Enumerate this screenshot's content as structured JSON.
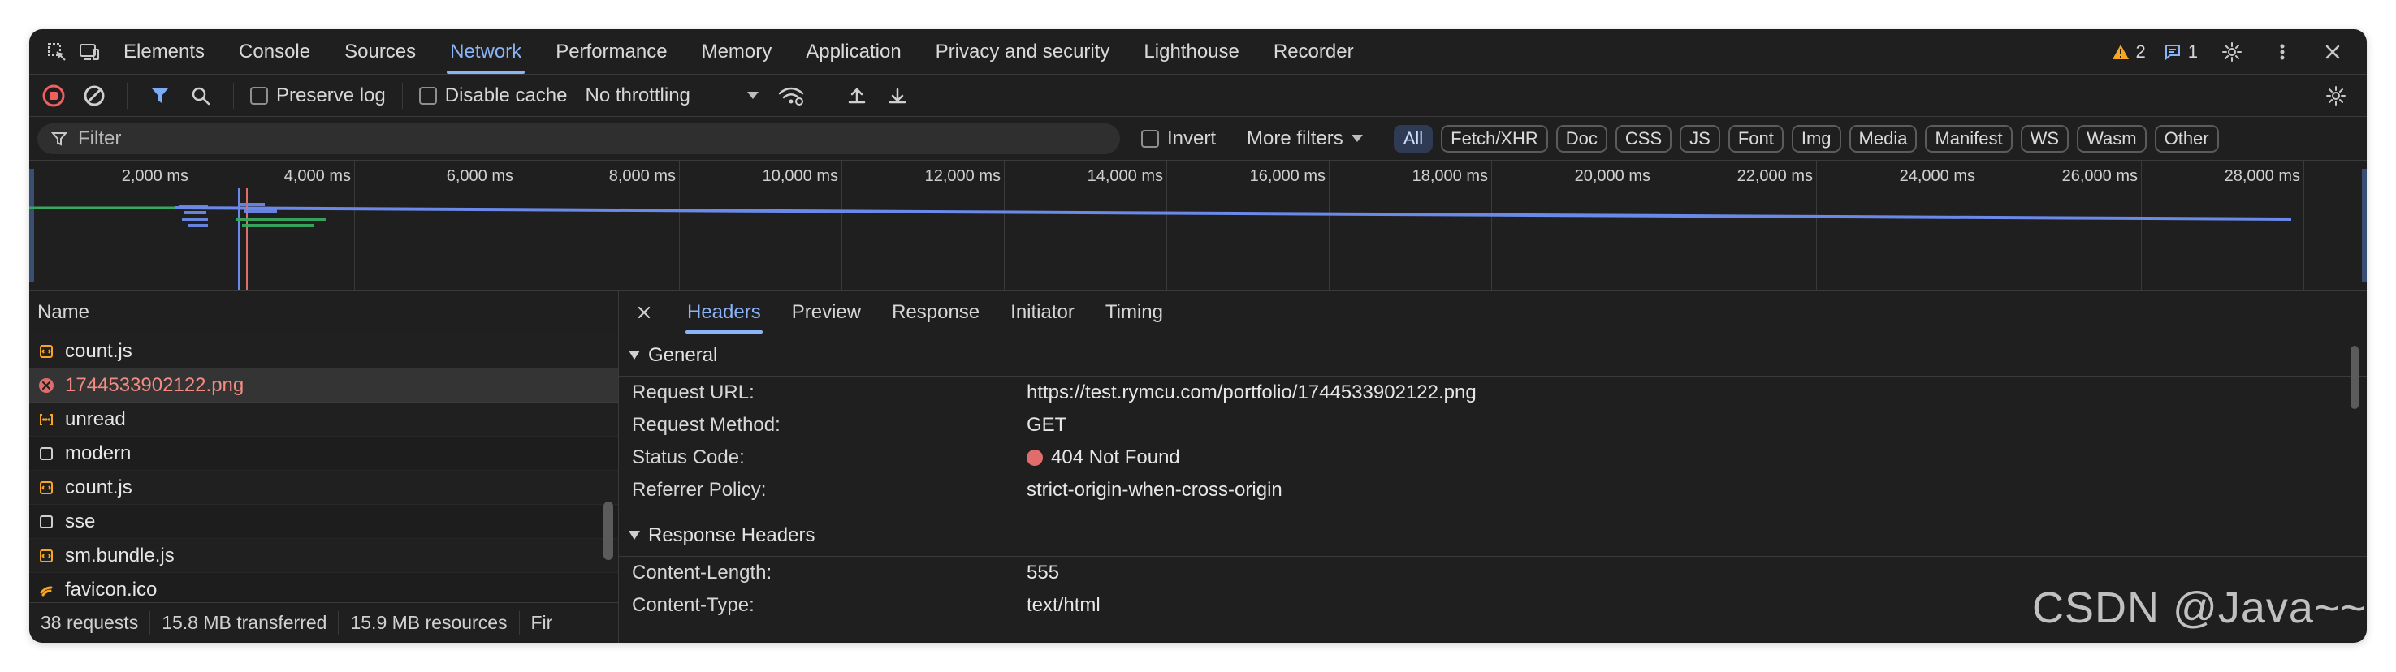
{
  "topbar": {
    "tabs": [
      "Elements",
      "Console",
      "Sources",
      "Network",
      "Performance",
      "Memory",
      "Application",
      "Privacy and security",
      "Lighthouse",
      "Recorder"
    ],
    "active_tab": "Network",
    "warnings_count": "2",
    "messages_count": "1"
  },
  "toolbar": {
    "preserve_log_label": "Preserve log",
    "disable_cache_label": "Disable cache",
    "throttling_value": "No throttling"
  },
  "filter": {
    "placeholder": "Filter",
    "invert_label": "Invert",
    "more_filters_label": "More filters",
    "chips": [
      "All",
      "Fetch/XHR",
      "Doc",
      "CSS",
      "JS",
      "Font",
      "Img",
      "Media",
      "Manifest",
      "WS",
      "Wasm",
      "Other"
    ],
    "active_chip": "All"
  },
  "timeline": {
    "ticks": [
      "2,000 ms",
      "4,000 ms",
      "6,000 ms",
      "8,000 ms",
      "10,000 ms",
      "12,000 ms",
      "14,000 ms",
      "16,000 ms",
      "18,000 ms",
      "20,000 ms",
      "22,000 ms",
      "24,000 ms",
      "26,000 ms",
      "28,000 ms"
    ]
  },
  "requests": {
    "column_name": "Name",
    "items": [
      {
        "name": "count.js",
        "type": "script",
        "status": "ok"
      },
      {
        "name": "1744533902122.png",
        "type": "image",
        "status": "error"
      },
      {
        "name": "unread",
        "type": "fetch",
        "status": "ok"
      },
      {
        "name": "modern",
        "type": "doc",
        "status": "ok"
      },
      {
        "name": "count.js",
        "type": "script",
        "status": "ok"
      },
      {
        "name": "sse",
        "type": "doc",
        "status": "ok"
      },
      {
        "name": "sm.bundle.js",
        "type": "script",
        "status": "ok"
      },
      {
        "name": "favicon.ico",
        "type": "favicon",
        "status": "ok"
      }
    ],
    "selected_index": 1
  },
  "status_bar": {
    "requests": "38 requests",
    "transferred": "15.8 MB transferred",
    "resources": "15.9 MB resources",
    "finish_truncated": "Fir"
  },
  "details": {
    "tabs": [
      "Headers",
      "Preview",
      "Response",
      "Initiator",
      "Timing"
    ],
    "active_tab": "Headers",
    "general_title": "General",
    "general": [
      {
        "k": "Request URL:",
        "v": "https://test.rymcu.com/portfolio/1744533902122.png"
      },
      {
        "k": "Request Method:",
        "v": "GET"
      },
      {
        "k": "Status Code:",
        "v": "404 Not Found"
      },
      {
        "k": "Referrer Policy:",
        "v": "strict-origin-when-cross-origin"
      }
    ],
    "response_headers_title": "Response Headers",
    "response_headers": [
      {
        "k": "Content-Length:",
        "v": "555"
      },
      {
        "k": "Content-Type:",
        "v": "text/html"
      }
    ]
  },
  "watermark": "CSDN @Java~~"
}
